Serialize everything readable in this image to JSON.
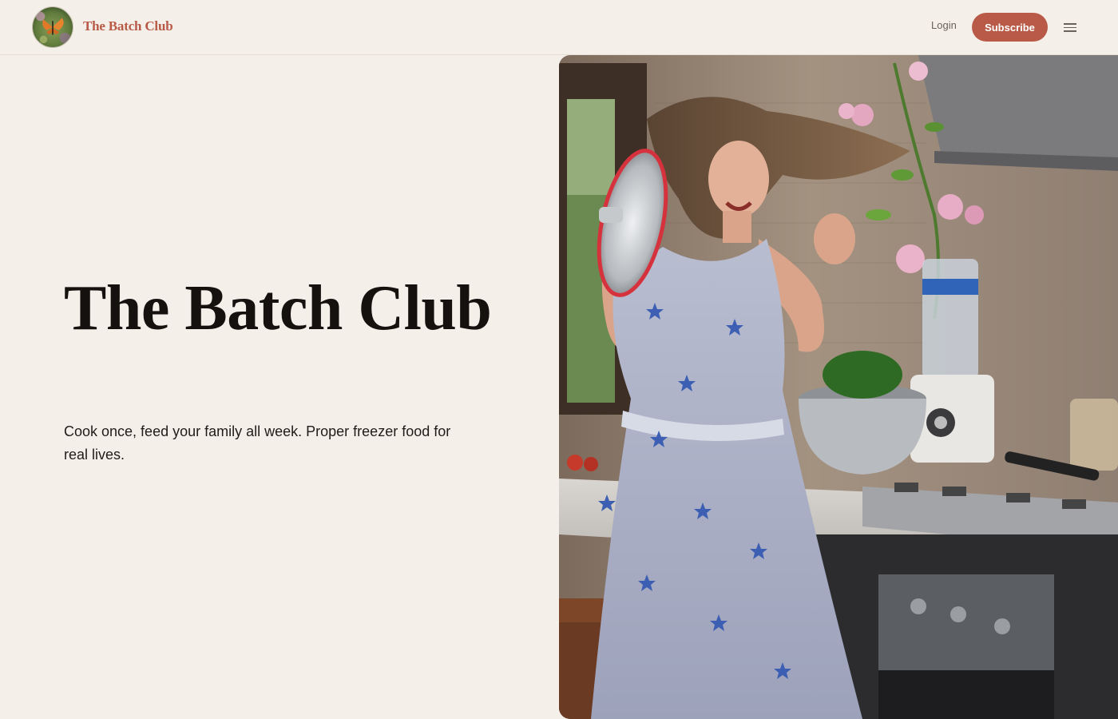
{
  "header": {
    "brand": "The Batch Club",
    "logo_icon": "butterfly-avatar-icon",
    "login_label": "Login",
    "subscribe_label": "Subscribe",
    "menu_icon": "hamburger-menu-icon"
  },
  "hero": {
    "title": "The Batch Club",
    "subtitle": "Cook once, feed your family all week. Proper freezer food for real lives."
  },
  "colors": {
    "background": "#f4efe8",
    "accent": "#b85a47",
    "text": "#14110f"
  }
}
